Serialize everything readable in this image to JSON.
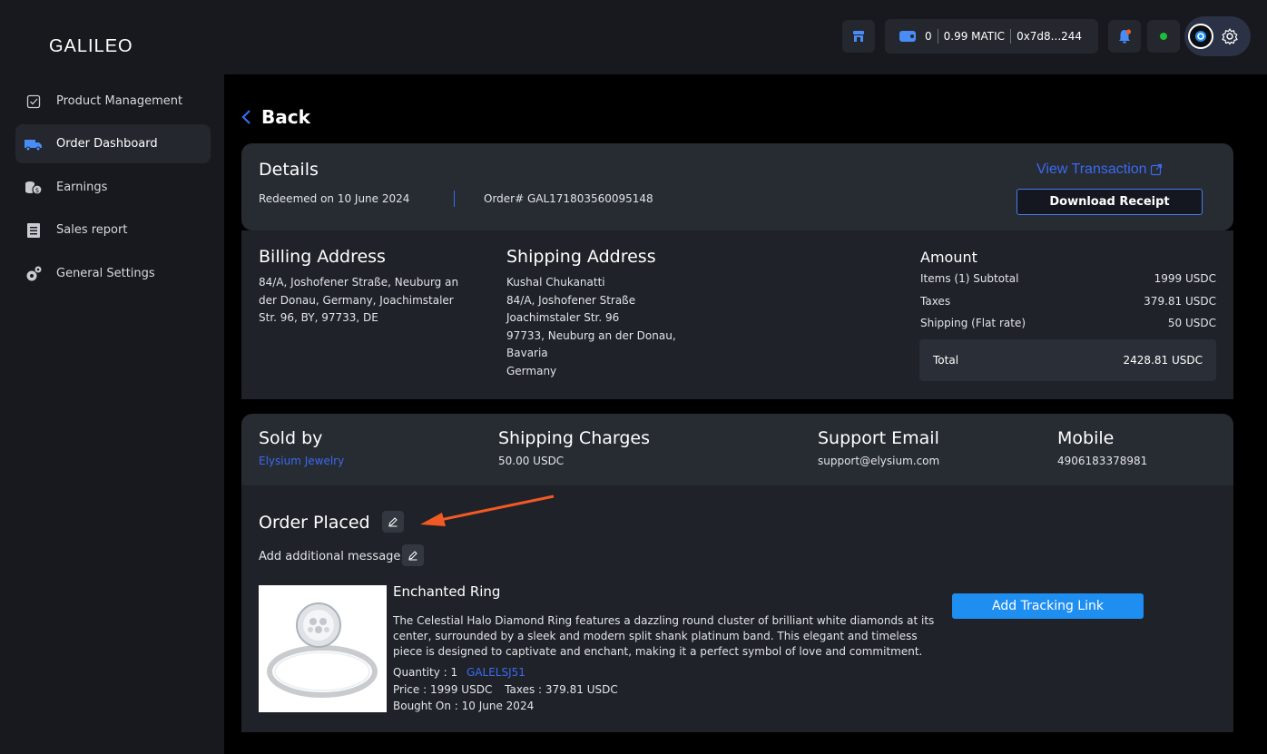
{
  "app": {
    "logo": "GALILEO"
  },
  "topbar": {
    "wallet_count": "0",
    "wallet_balance": "0.99 MATIC",
    "wallet_address": "0x7d8...244"
  },
  "sidebar": {
    "items": [
      {
        "label": "Product Management",
        "icon": "checkbox-icon"
      },
      {
        "label": "Order Dashboard",
        "icon": "truck-icon",
        "active": true
      },
      {
        "label": "Earnings",
        "icon": "coins-icon"
      },
      {
        "label": "Sales report",
        "icon": "report-icon"
      },
      {
        "label": "General Settings",
        "icon": "gears-icon"
      }
    ]
  },
  "back_label": "Back",
  "details": {
    "title": "Details",
    "redeemed": "Redeemed on 10 June 2024",
    "order_no": "Order# GAL171803560095148",
    "view_transaction": "View Transaction",
    "download_receipt": "Download Receipt"
  },
  "billing": {
    "title": "Billing Address",
    "lines": [
      "84/A, Joshofener Straße, Neuburg an",
      "der Donau, Germany, Joachimstaler",
      "Str. 96, BY, 97733, DE"
    ]
  },
  "shipping": {
    "title": "Shipping Address",
    "lines": [
      "Kushal Chukanatti",
      "84/A, Joshofener Straße",
      "Joachimstaler Str. 96",
      "97733, Neuburg an der Donau,",
      "Bavaria",
      "Germany"
    ]
  },
  "amount": {
    "title": "Amount",
    "rows": [
      {
        "label": "Items (1) Subtotal",
        "value": "1999 USDC"
      },
      {
        "label": "Taxes",
        "value": "379.81 USDC"
      },
      {
        "label": "Shipping (Flat rate)",
        "value": "50 USDC"
      }
    ],
    "total_label": "Total",
    "total_value": "2428.81 USDC"
  },
  "seller": {
    "sold_by_title": "Sold by",
    "sold_by_value": "Elysium Jewelry",
    "shipping_title": "Shipping Charges",
    "shipping_value": "50.00 USDC",
    "support_title": "Support Email",
    "support_value": "support@elysium.com",
    "mobile_title": "Mobile",
    "mobile_value": "4906183378981"
  },
  "order": {
    "status": "Order Placed",
    "add_message": "Add additional message",
    "product_name": "Enchanted Ring",
    "description": [
      "The Celestial Halo Diamond Ring features a dazzling round cluster of brilliant white diamonds at its",
      "center, surrounded by a sleek and modern split shank platinum band. This elegant and timeless",
      "piece is designed to captivate and enchant, making it a perfect symbol of love and commitment."
    ],
    "quantity_label": "Quantity : 1",
    "sku": "GALELSJ51",
    "price": "Price : 1999 USDC",
    "taxes": "Taxes : 379.81 USDC",
    "bought_on": "Bought On : 10 June 2024",
    "track_button": "Add Tracking Link"
  },
  "colors": {
    "accent": "#3b6af0",
    "button": "#1f8ef1",
    "arrow": "#f15a22"
  }
}
